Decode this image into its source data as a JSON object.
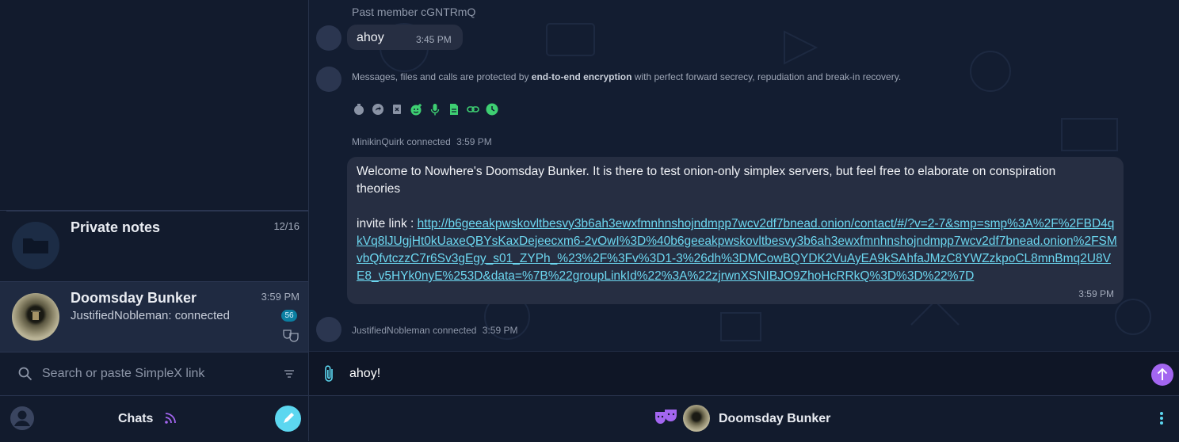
{
  "sidebar": {
    "chats": [
      {
        "name": "Private notes",
        "time": "12/16",
        "preview": ""
      },
      {
        "name": "Doomsday Bunker",
        "time": "3:59 PM",
        "preview": "JustifiedNobleman: connected",
        "unread": "56"
      }
    ],
    "search_placeholder": "Search or paste SimpleX link",
    "bottom_label": "Chats"
  },
  "messages": {
    "past_member": "Past member cGNTRmQ",
    "ahoy_text": "ahoy",
    "ahoy_time": "3:45 PM",
    "enc_prefix": "Messages, files and calls are protected by ",
    "enc_bold": "end-to-end encryption",
    "enc_suffix": " with perfect forward secrecy, repudiation and break-in recovery.",
    "event1_name": "MinikinQuirk",
    "event1_text": "connected",
    "event1_time": "3:59 PM",
    "welcome_line": "Welcome to Nowhere's Doomsday Bunker. It is there to test onion-only simplex servers, but feel free to elaborate on conspiration theories",
    "invite_label": "invite link : ",
    "invite_link": "http://b6geeakpwskovltbesvy3b6ah3ewxfmnhnshojndmpp7wcv2df7bnead.onion/contact/#/?v=2-7&smp=smp%3A%2F%2FBD4qkVq8lJUgjHt0kUaxeQBYsKaxDejeecxm6-2vOwI%3D%40b6geeakpwskovltbesvy3b6ah3ewxfmnhnshojndmpp7wcv2df7bnead.onion%2FSMvbQfvtczzC7r6Sv3gEgy_s01_ZYPh_%23%2F%3Fv%3D1-3%26dh%3DMCowBQYDK2VuAyEA9kSAhfaJMzC8YWZzkpoCL8mnBmq2U8VE8_v5HYk0nyE%253D&data=%7B%22groupLinkId%22%3A%22zjrwnXSNIBJO9ZhoHcRRkQ%3D%3D%22%7D",
    "welcome_time": "3:59 PM",
    "event2_name": "JustifiedNobleman",
    "event2_text": "connected",
    "event2_time": "3:59 PM"
  },
  "composer": {
    "value": "ahoy!"
  },
  "header": {
    "title": "Doomsday Bunker"
  },
  "colors": {
    "accent": "#a366f0",
    "teal": "#5cd7f0",
    "feature_green": "#3ecf72",
    "badge": "#0b7fa1"
  },
  "icons": [
    "search-icon",
    "filter-icon",
    "rss-icon",
    "compose-icon",
    "attach-icon",
    "send-icon",
    "menu-dots-icon",
    "incognito-mask-icon",
    "folder-icon"
  ]
}
